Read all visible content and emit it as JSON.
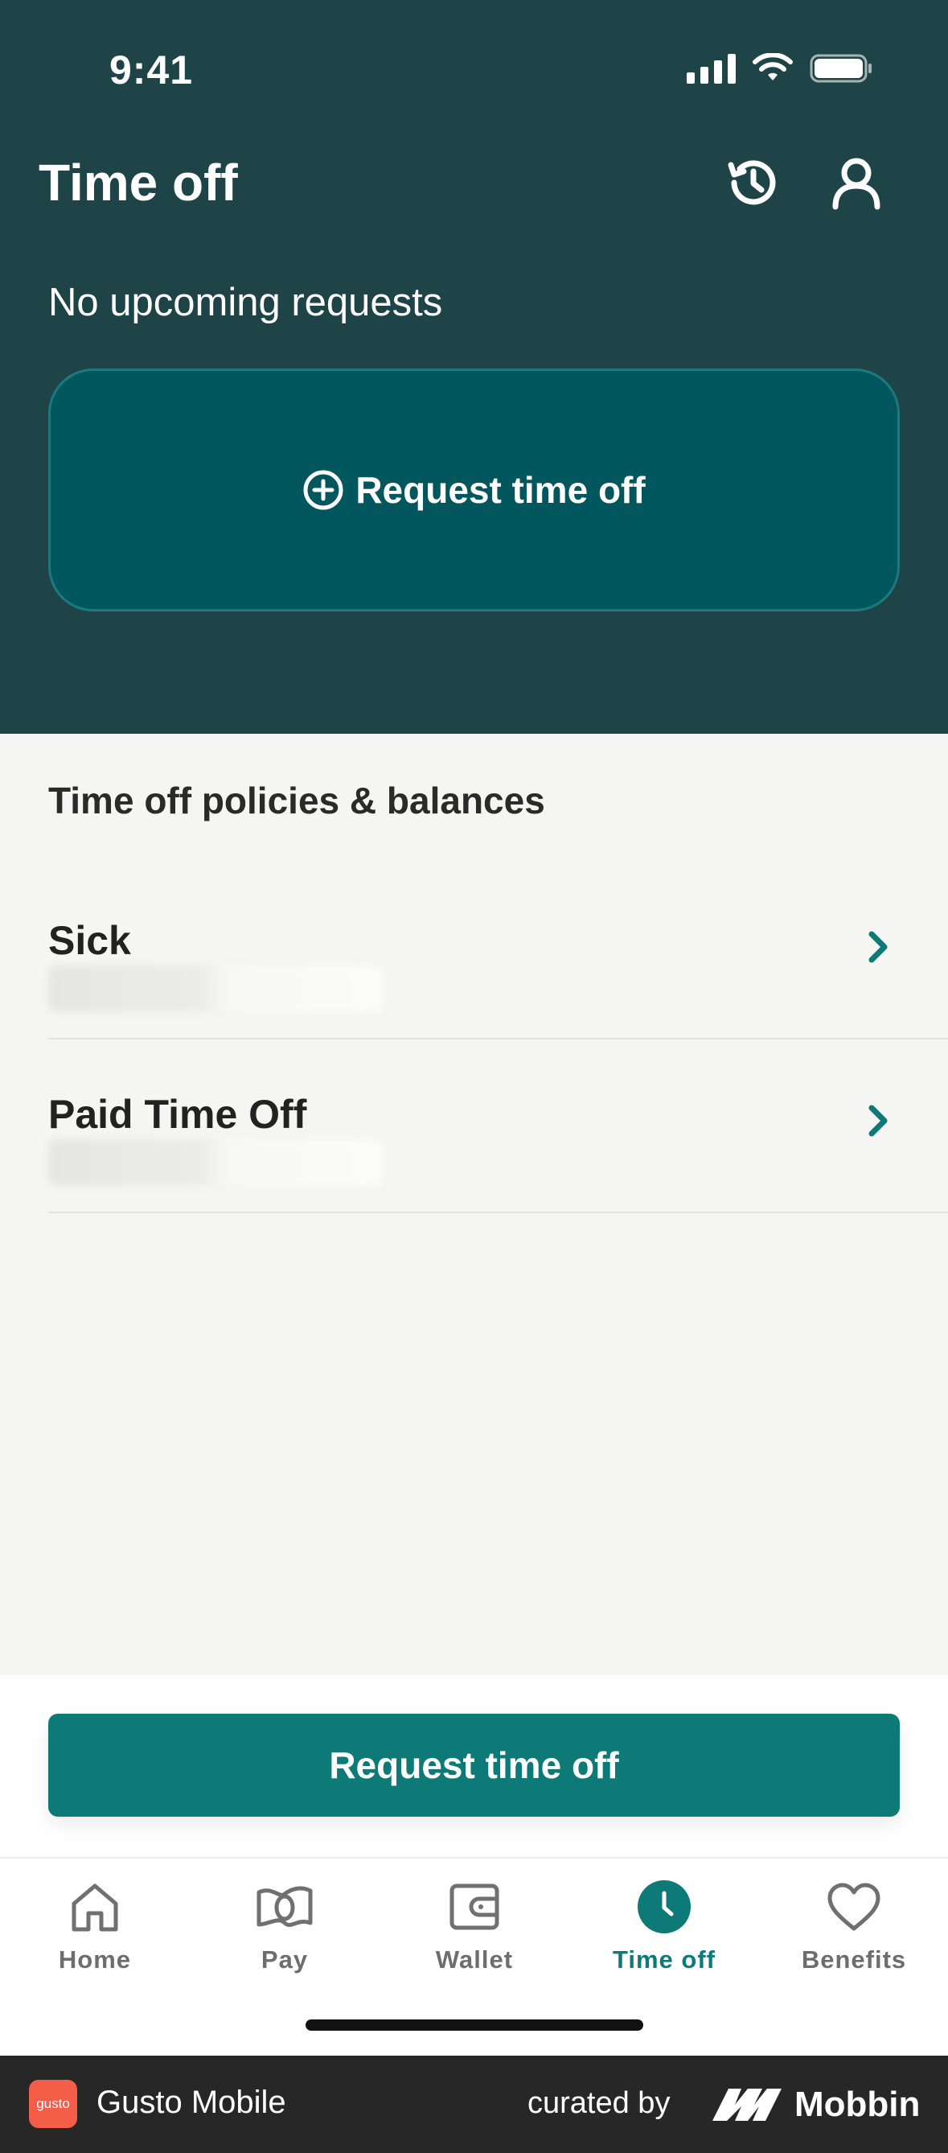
{
  "status_bar": {
    "time": "9:41"
  },
  "header": {
    "title": "Time off",
    "history_icon": "history-icon",
    "profile_icon": "profile-icon",
    "empty_text": "No upcoming requests",
    "request_card_label": "Request time off"
  },
  "policies": {
    "title": "Time off policies & balances",
    "items": [
      {
        "name": "Sick"
      },
      {
        "name": "Paid Time Off"
      }
    ]
  },
  "primary_button": {
    "label": "Request time off"
  },
  "tabbar": {
    "items": [
      {
        "label": "Home",
        "icon": "home-icon",
        "active": false
      },
      {
        "label": "Pay",
        "icon": "money-icon",
        "active": false
      },
      {
        "label": "Wallet",
        "icon": "wallet-icon",
        "active": false
      },
      {
        "label": "Time off",
        "icon": "clock-icon",
        "active": true
      },
      {
        "label": "Benefits",
        "icon": "heart-icon",
        "active": false
      }
    ]
  },
  "footer": {
    "logo_text": "gusto",
    "app_name": "Gusto Mobile",
    "curated_by": "curated by",
    "curator": "Mobbin"
  },
  "colors": {
    "header_bg": "#1e4447",
    "card_bg": "#02575f",
    "accent": "#0d7a78",
    "page_bg": "#f5f5f3"
  }
}
